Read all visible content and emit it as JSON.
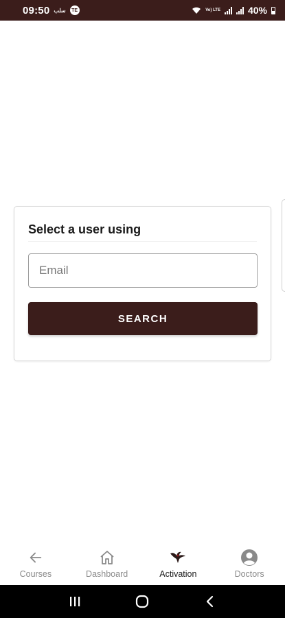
{
  "status_bar": {
    "time": "09:50",
    "left_small_text": "سلب",
    "left_circle_text": "TE",
    "network_text": "Vo) LTE",
    "battery": "40%"
  },
  "card": {
    "title": "Select a user using",
    "email_placeholder": "Email",
    "search_label": "SEARCH"
  },
  "bottom_nav": {
    "items": [
      {
        "label": "Courses",
        "icon": "back-arrow-icon",
        "active": false
      },
      {
        "label": "Dashboard",
        "icon": "home-icon",
        "active": false
      },
      {
        "label": "Activation",
        "icon": "eagle-icon",
        "active": true
      },
      {
        "label": "Doctors",
        "icon": "person-circle-icon",
        "active": false
      }
    ]
  },
  "system_nav": {
    "icons": [
      "recents-icon",
      "home-circle-icon",
      "back-chevron-icon"
    ]
  },
  "colors": {
    "brand": "#3b1d1b",
    "nav_inactive": "#8a8a8a",
    "nav_active": "#1a1a1a"
  }
}
